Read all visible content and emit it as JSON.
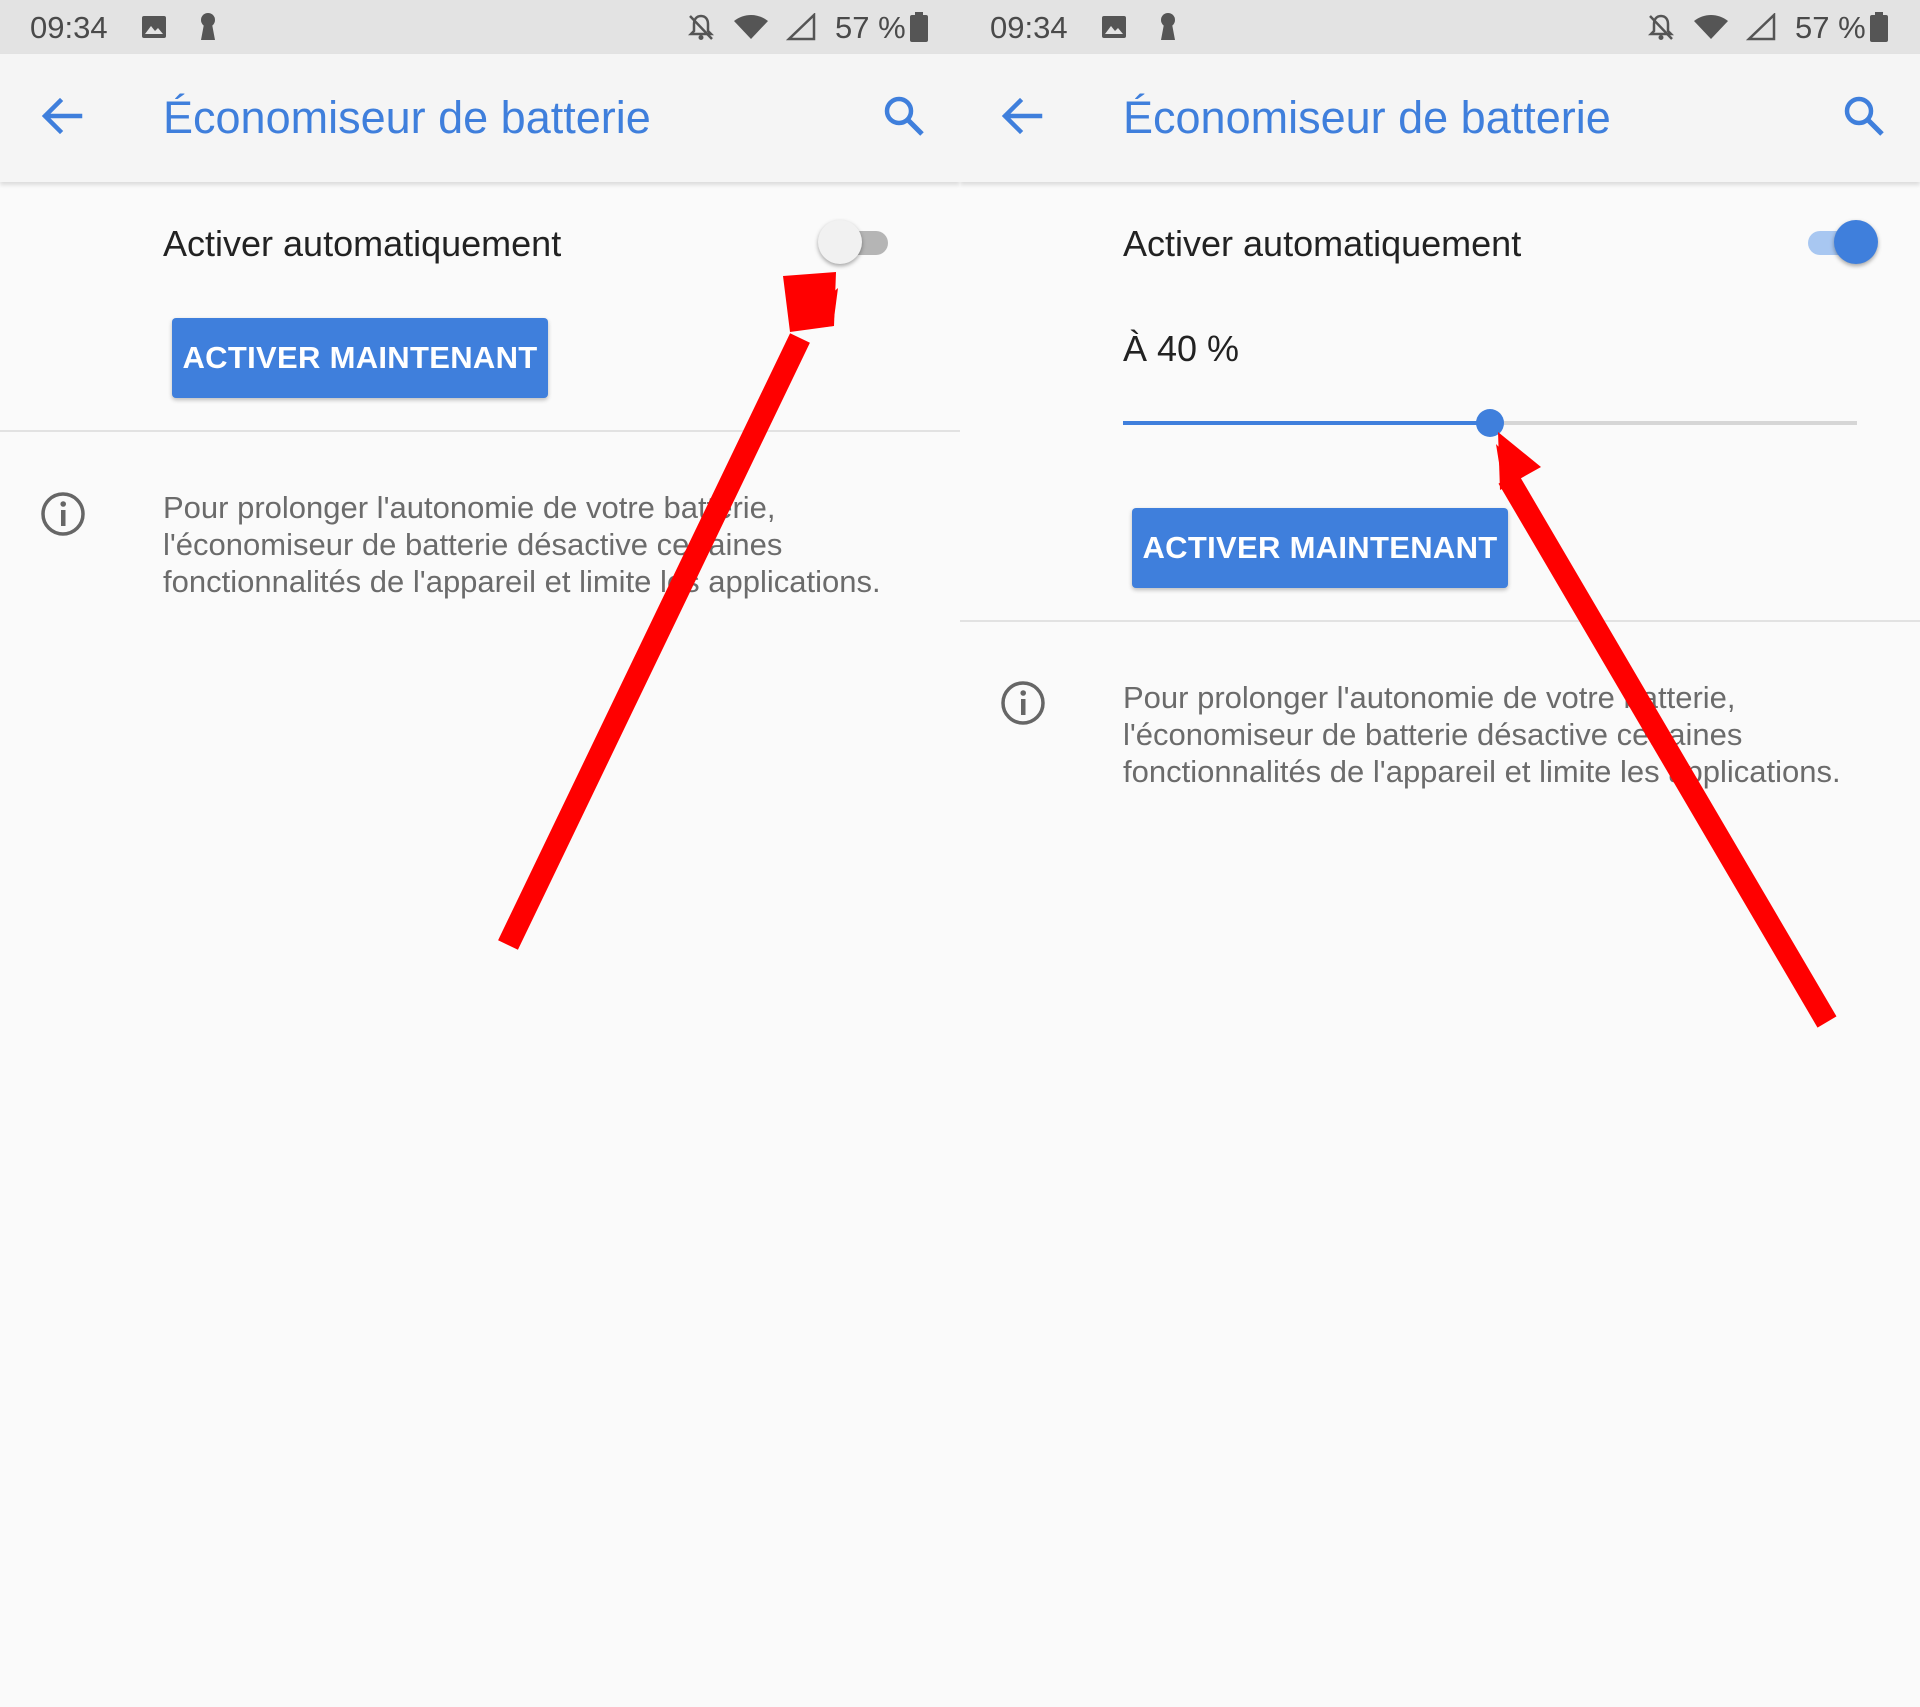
{
  "colors": {
    "accent": "#3f7fdc",
    "status_bar": "#e3e3e3",
    "app_bar": "#f5f5f5",
    "background": "#fafafa",
    "annotation_arrow": "#ff0000"
  },
  "screens": [
    {
      "status_bar": {
        "time": "09:34",
        "battery_percent": "57 %",
        "icons": [
          "image-icon",
          "keyhole-icon",
          "bell-off-icon",
          "wifi-icon",
          "signal-icon",
          "battery-icon"
        ]
      },
      "app_bar": {
        "title": "Économiseur de batterie",
        "back_icon": "arrow-back-icon",
        "search_icon": "search-icon"
      },
      "auto_enable": {
        "label": "Activer automatiquement",
        "checked": false
      },
      "enable_now_button": "ACTIVER MAINTENANT",
      "info": {
        "icon": "info-icon",
        "text": "Pour prolonger l'autonomie de votre batterie, l'économiseur de batterie désactive certaines fonctionnalités de l'appareil et limite les applications."
      },
      "annotation": {
        "icon": "red-arrow",
        "points_to": "auto-enable-switch"
      }
    },
    {
      "status_bar": {
        "time": "09:34",
        "battery_percent": "57 %",
        "icons": [
          "image-icon",
          "keyhole-icon",
          "bell-off-icon",
          "wifi-icon",
          "signal-icon",
          "battery-icon"
        ]
      },
      "app_bar": {
        "title": "Économiseur de batterie",
        "back_icon": "arrow-back-icon",
        "search_icon": "search-icon"
      },
      "auto_enable": {
        "label": "Activer automatiquement",
        "checked": true
      },
      "threshold": {
        "label": "À 40 %",
        "slider_fraction": 0.5
      },
      "enable_now_button": "ACTIVER MAINTENANT",
      "info": {
        "icon": "info-icon",
        "text": "Pour prolonger l'autonomie de votre batterie, l'économiseur de batterie désactive certaines fonctionnalités de l'appareil et limite les applications."
      },
      "annotation": {
        "icon": "red-arrow",
        "points_to": "threshold-slider"
      }
    }
  ]
}
